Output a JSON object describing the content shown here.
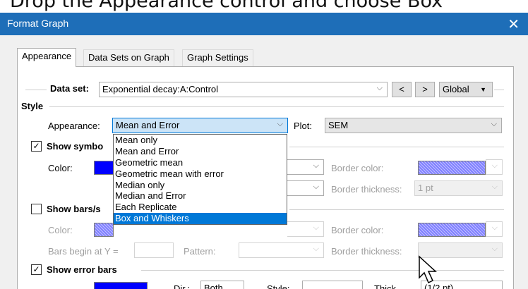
{
  "instruction": "Drop the Appearance control and choose Box",
  "window": {
    "title": "Format Graph",
    "close_glyph": "✕"
  },
  "tabs": [
    {
      "label": "Appearance",
      "active": true
    },
    {
      "label": "Data Sets on Graph",
      "active": false
    },
    {
      "label": "Graph Settings",
      "active": false
    }
  ],
  "dataset": {
    "label": "Data set:",
    "value": "Exponential decay:A:Control",
    "prev_button": "<",
    "next_button": ">",
    "scope": "Global"
  },
  "style": {
    "header": "Style",
    "appearance_label": "Appearance:",
    "appearance_value": "Mean and Error",
    "plot_label": "Plot:",
    "plot_value": "SEM"
  },
  "appearance_options": [
    "Mean only",
    "Mean and Error",
    "Geometric mean",
    "Geometric mean with error",
    "Median only",
    "Median and Error",
    "Each Replicate",
    "Box and Whiskers"
  ],
  "appearance_highlighted": "Box and Whiskers",
  "symbols": {
    "checkbox_label": "Show symbo",
    "checked": true,
    "color_label": "Color:",
    "color": "#0000ff",
    "border_color_label": "Border color:",
    "border_thickness_label": "Border thickness:",
    "border_thickness_value": "1 pt"
  },
  "bars": {
    "checkbox_label": "Show bars/s",
    "checked": false,
    "color_label": "Color:",
    "border_color_label": "Border color:",
    "bars_begin_label": "Bars begin at Y =",
    "pattern_label": "Pattern:",
    "border_thickness_label": "Border thickness:"
  },
  "error_bars": {
    "checkbox_label": "Show error bars",
    "checked": true,
    "color": "#0000ff",
    "dir_label": "Dir.:",
    "dir_value": "Both",
    "style_label": "Style:",
    "thickness_label": "Thick",
    "thickness_value": "(1/2 pt)"
  },
  "icons": {
    "checkmark": "✓",
    "dropdown_arrow": "⌵",
    "close": "close-icon"
  },
  "colors": {
    "titlebar": "#1e6eb8",
    "selection": "#0078d7",
    "symbol_color": "#0000ff",
    "hatch_color": "#8080ff"
  }
}
